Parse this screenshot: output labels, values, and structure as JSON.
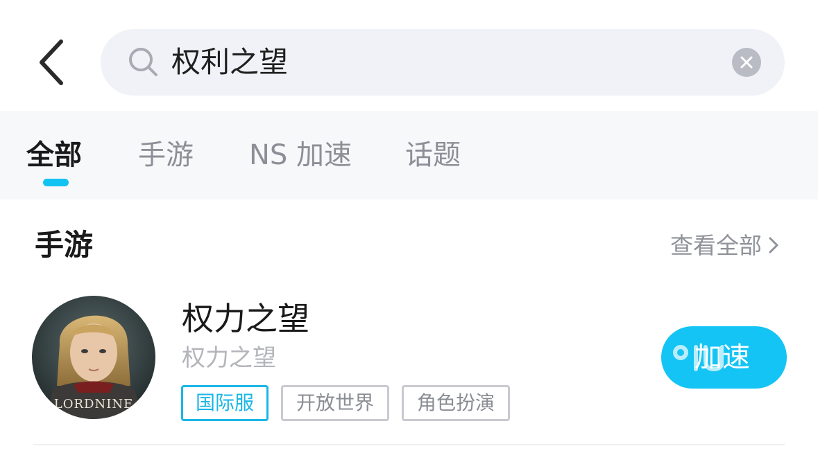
{
  "search": {
    "query": "权利之望"
  },
  "tabs": [
    {
      "label": "全部",
      "active": true
    },
    {
      "label": "手游",
      "active": false
    },
    {
      "label": "NS 加速",
      "active": false
    },
    {
      "label": "话题",
      "active": false
    }
  ],
  "section": {
    "title": "手游",
    "see_all_label": "查看全部"
  },
  "game": {
    "title": "权力之望",
    "subtitle": "权力之望",
    "icon_text": "LORDNINE",
    "tags": [
      "国际服",
      "开放世界",
      "角色扮演"
    ],
    "action_label": "加速"
  },
  "colors": {
    "accent": "#14c4f4",
    "tag_primary": "#1ab6e6",
    "tab_bg": "#f7f8fa",
    "search_bg": "#f1f2f7"
  }
}
